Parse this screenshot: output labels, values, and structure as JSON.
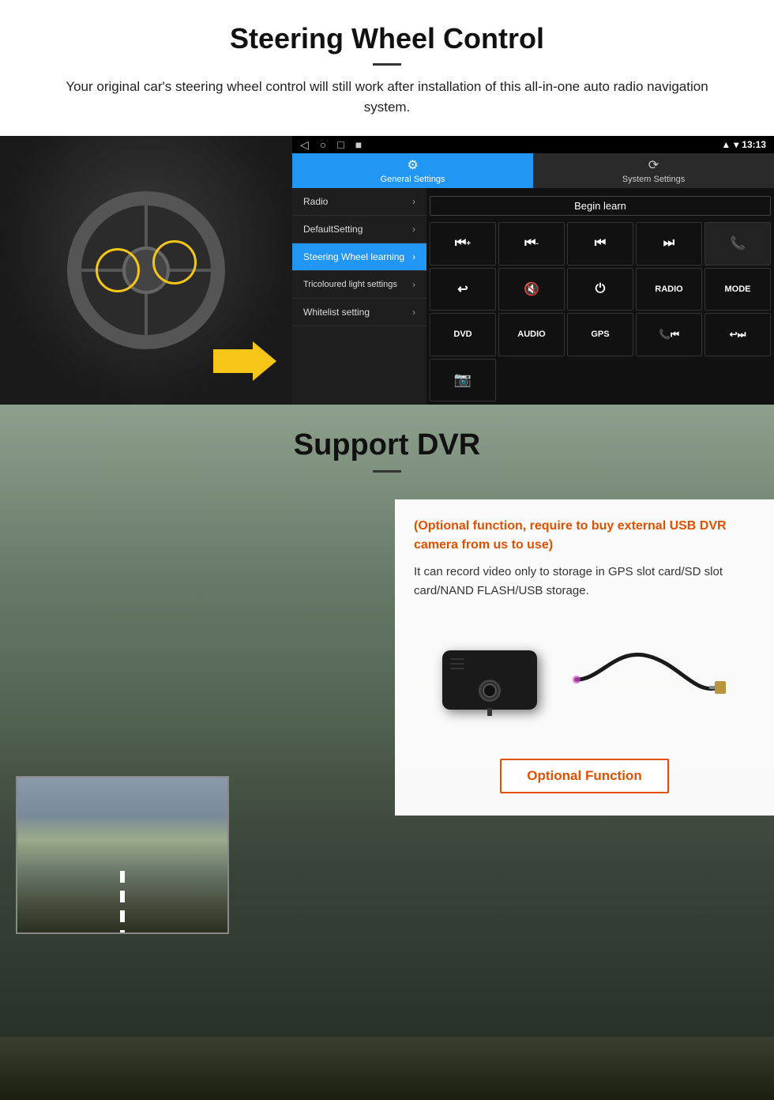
{
  "page": {
    "section1": {
      "title": "Steering Wheel Control",
      "description": "Your original car's steering wheel control will still work after installation of this all-in-one auto radio navigation system.",
      "android_ui": {
        "status_bar": {
          "time": "13:13",
          "nav_icons": [
            "◁",
            "○",
            "□",
            "■"
          ]
        },
        "tabs": [
          {
            "id": "general",
            "icon": "⚙",
            "label": "General Settings",
            "active": true
          },
          {
            "id": "system",
            "icon": "🔄",
            "label": "System Settings",
            "active": false
          }
        ],
        "menu_items": [
          {
            "label": "Radio",
            "active": false
          },
          {
            "label": "DefaultSetting",
            "active": false
          },
          {
            "label": "Steering Wheel learning",
            "active": true
          },
          {
            "label": "Tricoloured light settings",
            "active": false
          },
          {
            "label": "Whitelist setting",
            "active": false
          }
        ],
        "begin_learn_label": "Begin learn",
        "control_buttons": [
          [
            "⏮+",
            "⏮-",
            "⏮",
            "⏭",
            "📞"
          ],
          [
            "↩",
            "🔇",
            "⏻",
            "RADIO",
            "MODE"
          ],
          [
            "DVD",
            "AUDIO",
            "GPS",
            "📞⏮",
            "↩⏭"
          ],
          [
            "📷"
          ]
        ]
      }
    },
    "section2": {
      "title": "Support DVR",
      "card": {
        "orange_text": "(Optional function, require to buy external USB DVR camera from us to use)",
        "description": "It can record video only to storage in GPS slot card/SD slot card/NAND FLASH/USB storage.",
        "optional_button_label": "Optional Function"
      }
    }
  }
}
